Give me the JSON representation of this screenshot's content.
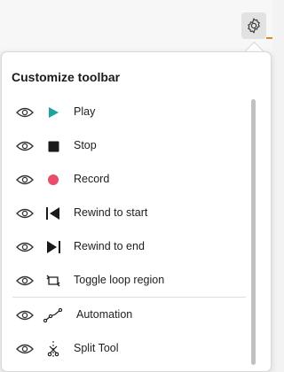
{
  "toolbar": {
    "settings_icon": "gear-icon"
  },
  "menu": {
    "title": "Customize toolbar",
    "items": [
      {
        "label": "Play",
        "icon": "play-icon"
      },
      {
        "label": "Stop",
        "icon": "stop-icon"
      },
      {
        "label": "Record",
        "icon": "record-icon"
      },
      {
        "label": "Rewind to start",
        "icon": "rewind-to-start-icon"
      },
      {
        "label": "Rewind to end",
        "icon": "rewind-to-end-icon"
      },
      {
        "label": "Toggle loop region",
        "icon": "loop-icon"
      },
      {
        "label": "Automation",
        "icon": "automation-icon"
      },
      {
        "label": "Split Tool",
        "icon": "split-tool-icon"
      }
    ],
    "colors": {
      "play": "#1fa2a0",
      "record": "#e84d6b",
      "stop": "#1a1a1a"
    }
  }
}
